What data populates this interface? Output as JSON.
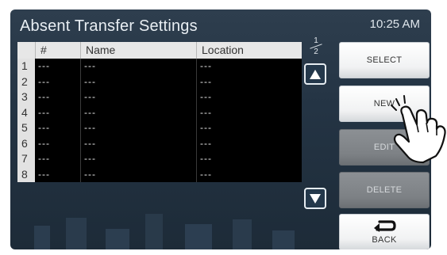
{
  "screen": {
    "title": "Absent Transfer Settings",
    "time": "10:25 AM"
  },
  "table": {
    "headers": {
      "num": "#",
      "name": "Name",
      "location": "Location"
    },
    "rows": [
      {
        "index": "1",
        "num": "---",
        "name": "---",
        "location": "---"
      },
      {
        "index": "2",
        "num": "---",
        "name": "---",
        "location": "---"
      },
      {
        "index": "3",
        "num": "---",
        "name": "---",
        "location": "---"
      },
      {
        "index": "4",
        "num": "---",
        "name": "---",
        "location": "---"
      },
      {
        "index": "5",
        "num": "---",
        "name": "---",
        "location": "---"
      },
      {
        "index": "6",
        "num": "---",
        "name": "---",
        "location": "---"
      },
      {
        "index": "7",
        "num": "---",
        "name": "---",
        "location": "---"
      },
      {
        "index": "8",
        "num": "---",
        "name": "---",
        "location": "---"
      }
    ]
  },
  "pagination": {
    "current": "1",
    "total": "2"
  },
  "buttons": {
    "select": "SELECT",
    "new": "NEW",
    "edit": "EDIT",
    "delete": "DELETE",
    "back": "BACK"
  },
  "icons": {
    "scroll_up": "triangle-up-icon",
    "scroll_down": "triangle-down-icon",
    "back": "return-arrow-icon",
    "pointer": "hand-pointer-icon"
  },
  "colors": {
    "panel_bg": "#243444",
    "table_cell_bg": "#000000",
    "header_bg": "#e7e7e7",
    "button_light": "#f1f2f3",
    "button_disabled": "#7d8185"
  }
}
